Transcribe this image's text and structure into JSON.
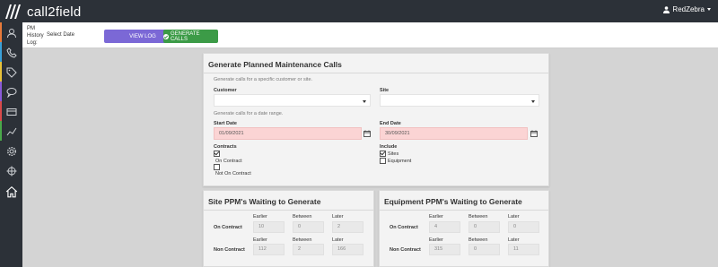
{
  "app": {
    "brand": "call2field",
    "user": "RedZebra"
  },
  "toolbar": {
    "pm_label": "PM History Log:",
    "date_select": "Select Date",
    "view_log": "VIEW LOG",
    "generate_calls": "GENERATE CALLS"
  },
  "sidebar": {
    "items": [
      {
        "icon": "user-icon",
        "color": "#e87a3a"
      },
      {
        "icon": "phone-icon",
        "color": "#3aa0d8"
      },
      {
        "icon": "tag-icon",
        "color": "#e8c23a"
      },
      {
        "icon": "chat-icon",
        "color": "#8a5ad8"
      },
      {
        "icon": "card-icon",
        "color": "#d84a4a"
      },
      {
        "icon": "chart-icon",
        "color": "#4aa84a"
      },
      {
        "icon": "gear-icon",
        "color": "#9a9a9a"
      },
      {
        "icon": "target-icon",
        "color": "#d8d8d8"
      },
      {
        "icon": "home-icon",
        "color": "#ffffff"
      }
    ]
  },
  "main": {
    "title": "Generate Planned Maintenance Calls",
    "hint_customer": "Generate calls for a specific customer or site.",
    "customer_label": "Customer",
    "site_label": "Site",
    "hint_date": "Generate calls for a date range.",
    "start_date_label": "Start Date",
    "start_date": "01/09/2021",
    "end_date_label": "End Date",
    "end_date": "30/09/2021",
    "contracts_label": "Contracts",
    "on_contract": "On Contract",
    "not_on_contract": "Not On Contract",
    "on_contract_checked": true,
    "not_on_contract_checked": false,
    "include_label": "Include",
    "sites": "Sites",
    "equipment": "Equipment",
    "sites_checked": true,
    "equipment_checked": false
  },
  "site_ppm": {
    "title": "Site PPM's Waiting to Generate",
    "col_earlier": "Earlier",
    "col_between": "Between",
    "col_later": "Later",
    "row_on": "On Contract",
    "row_non": "Non Contract",
    "on": {
      "earlier": "10",
      "between": "0",
      "later": "2"
    },
    "non": {
      "earlier": "112",
      "between": "2",
      "later": "166"
    }
  },
  "equipment_ppm": {
    "title": "Equipment PPM's Waiting to Generate",
    "col_earlier": "Earlier",
    "col_between": "Between",
    "col_later": "Later",
    "row_on": "On Contract",
    "row_non": "Non Contract",
    "on": {
      "earlier": "4",
      "between": "0",
      "later": "0"
    },
    "non": {
      "earlier": "315",
      "between": "0",
      "later": "11"
    }
  }
}
